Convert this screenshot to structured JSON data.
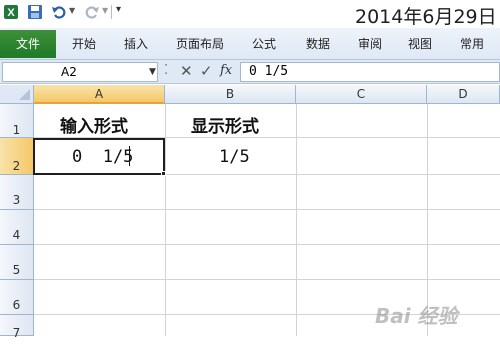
{
  "title_bar": {
    "title": "2014年6月29日",
    "icons": [
      "excel-icon",
      "save-icon",
      "undo-icon",
      "redo-icon",
      "customize-icon"
    ]
  },
  "ribbon": {
    "file_tab": "文件",
    "tabs": [
      "开始",
      "插入",
      "页面布局",
      "公式",
      "数据",
      "审阅",
      "视图",
      "常用"
    ]
  },
  "formula_bar": {
    "name_box": "A2",
    "fx_label": "fx",
    "formula": "0 1/5"
  },
  "grid": {
    "columns": [
      "A",
      "B",
      "C",
      "D"
    ],
    "rows": [
      "1",
      "2",
      "3",
      "4",
      "5",
      "6",
      "7"
    ],
    "selected_column": "A",
    "selected_row": "2",
    "cells": {
      "A1": "输入形式",
      "B1": "显示形式",
      "A2": "0  1/5",
      "B2": "1/5"
    }
  },
  "watermark": "Bai 经验"
}
